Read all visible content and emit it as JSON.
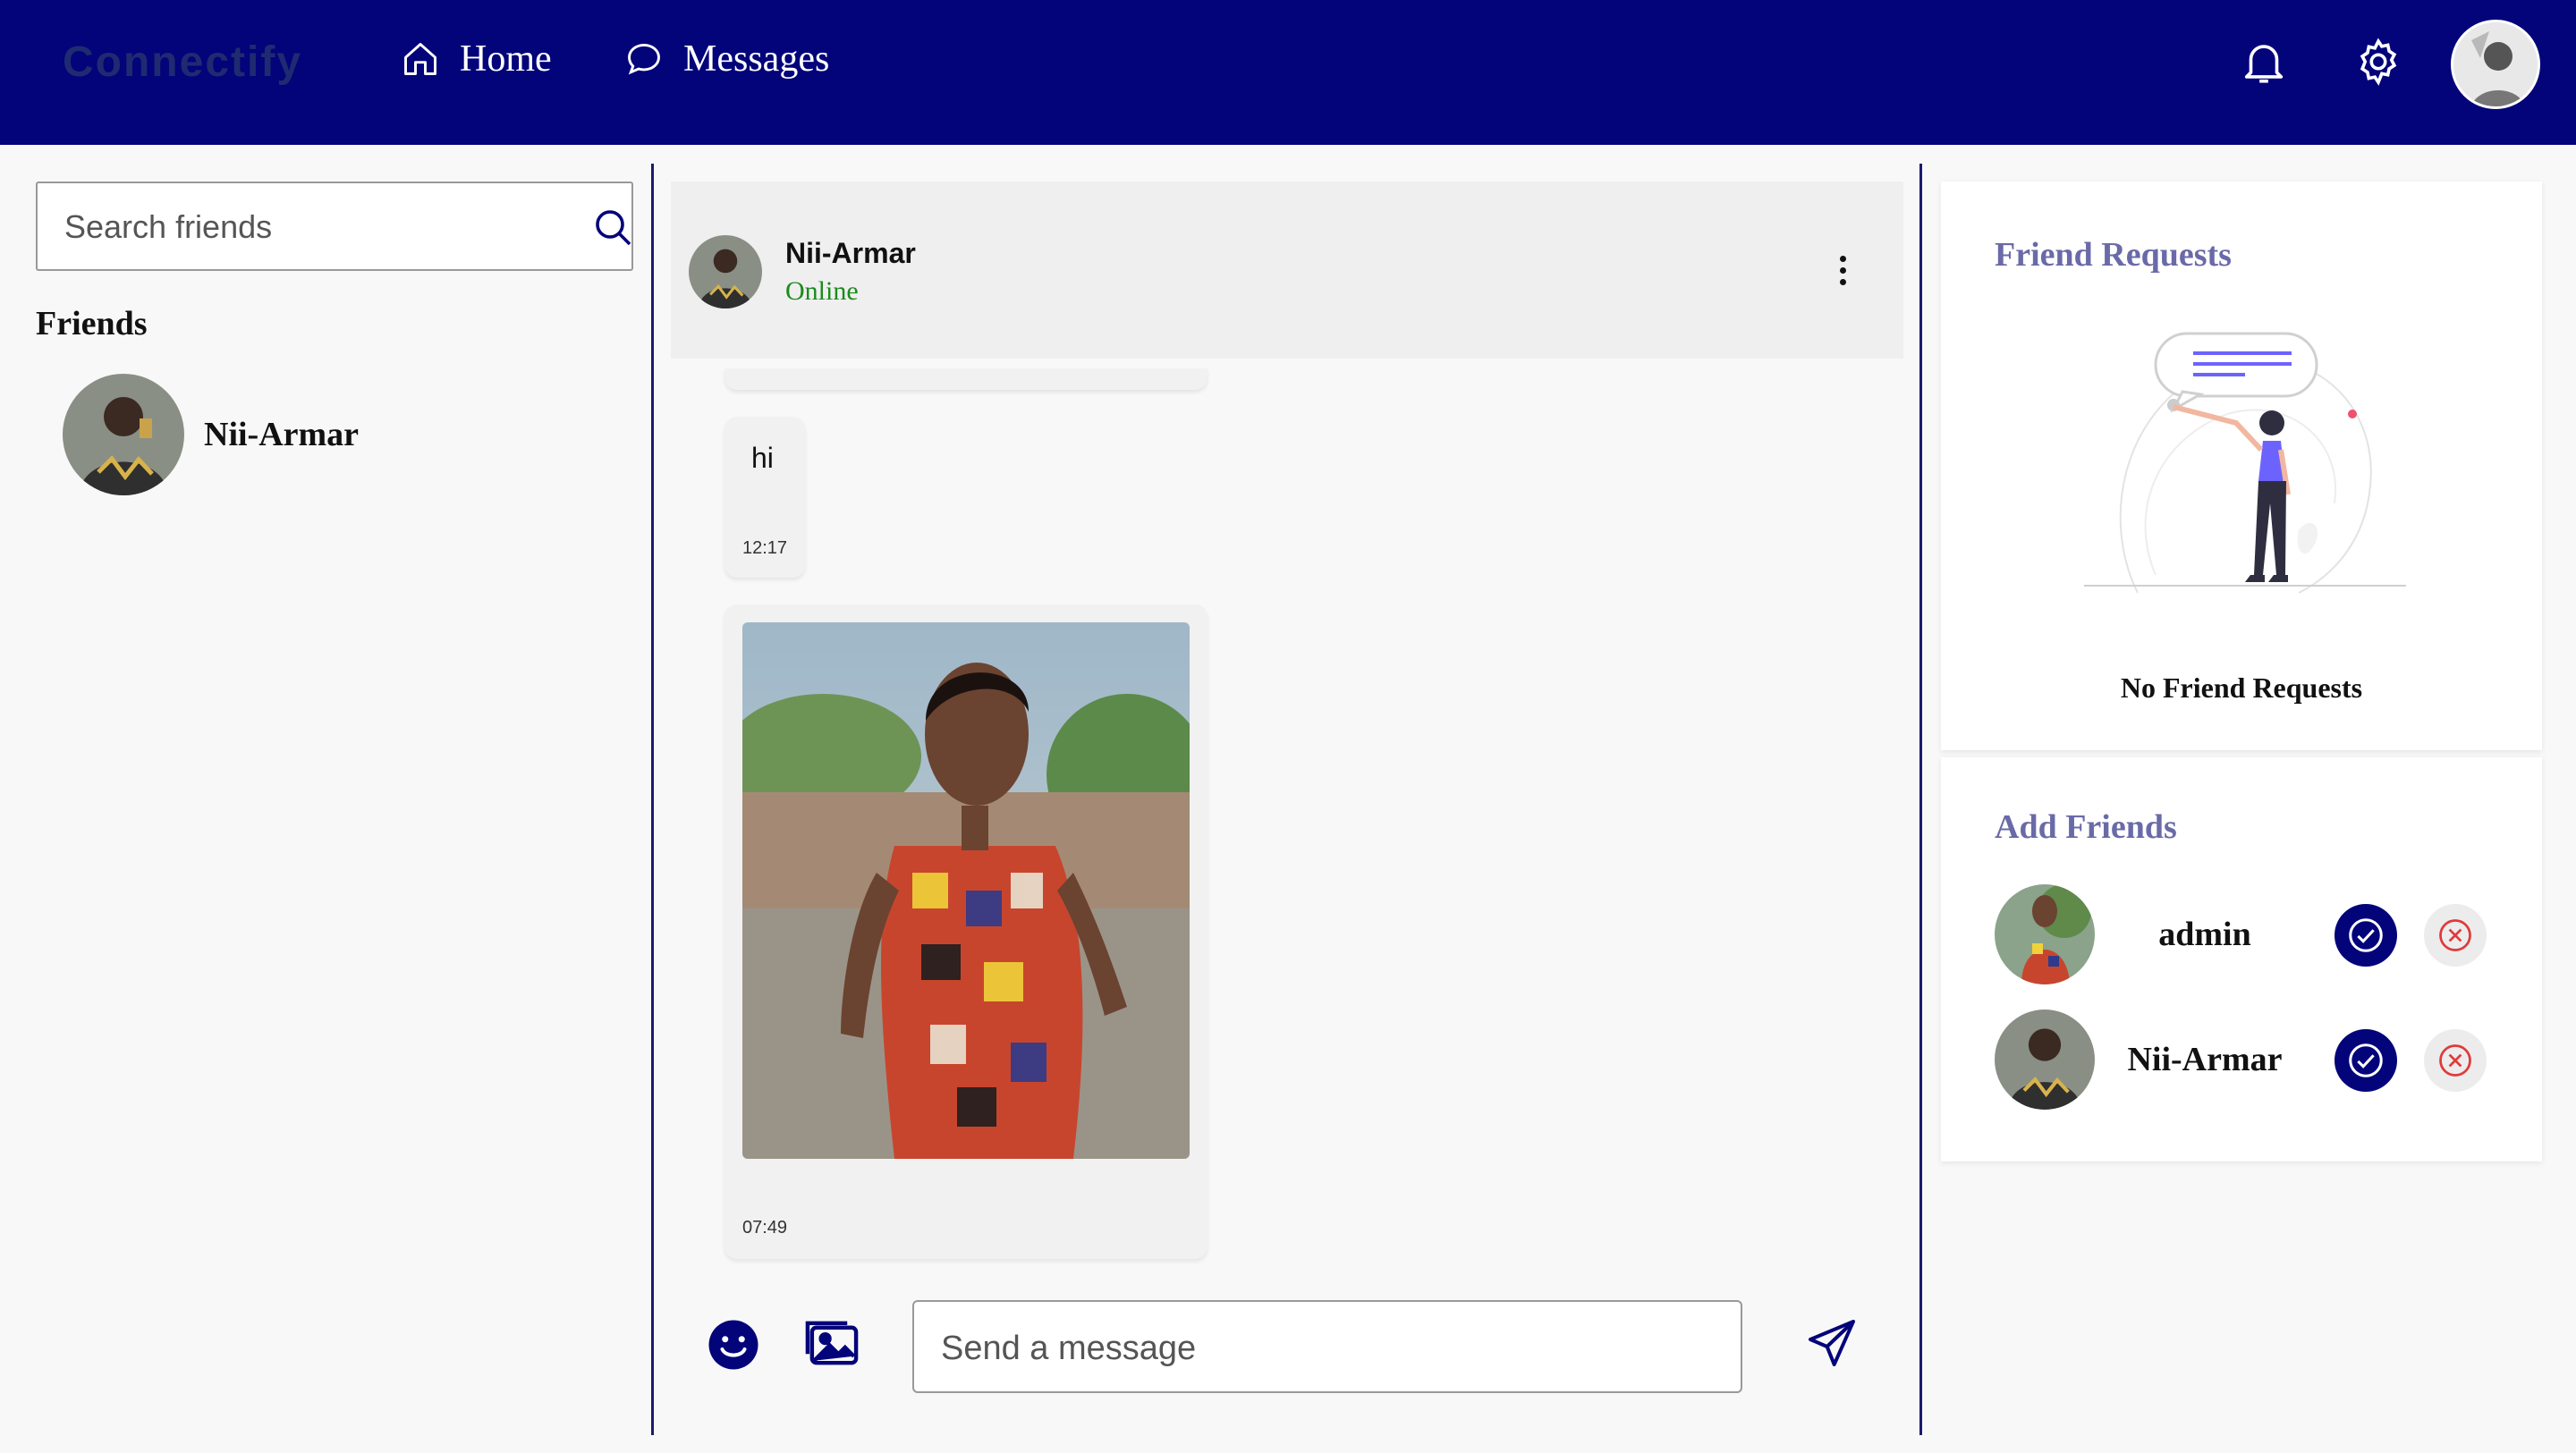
{
  "header": {
    "brand": "Connectify",
    "nav": [
      {
        "label": "Home",
        "icon": "home-icon"
      },
      {
        "label": "Messages",
        "icon": "chat-bubble-icon"
      }
    ],
    "icons": [
      "bell-icon",
      "gear-icon",
      "avatar"
    ],
    "background": "#03037a"
  },
  "sidebar": {
    "search": {
      "placeholder": "Search friends",
      "value": ""
    },
    "friends_title": "Friends",
    "friends": [
      {
        "name": "Nii-Armar"
      }
    ]
  },
  "chat": {
    "contact_name": "Nii-Armar",
    "contact_status": "Online",
    "messages": [
      {
        "type": "text",
        "text": "hi",
        "time": "12:17"
      },
      {
        "type": "image",
        "time": "07:49"
      }
    ],
    "composer": {
      "placeholder": "Send a message",
      "value": ""
    }
  },
  "friend_requests": {
    "title": "Friend Requests",
    "empty_text": "No Friend Requests"
  },
  "add_friends": {
    "title": "Add Friends",
    "people": [
      {
        "name": "admin"
      },
      {
        "name": "Nii-Armar"
      }
    ]
  },
  "colors": {
    "primary": "#03037a",
    "online": "#1c8a1c",
    "panel_title": "#6a6aa8",
    "reject": "#e03a3a"
  }
}
